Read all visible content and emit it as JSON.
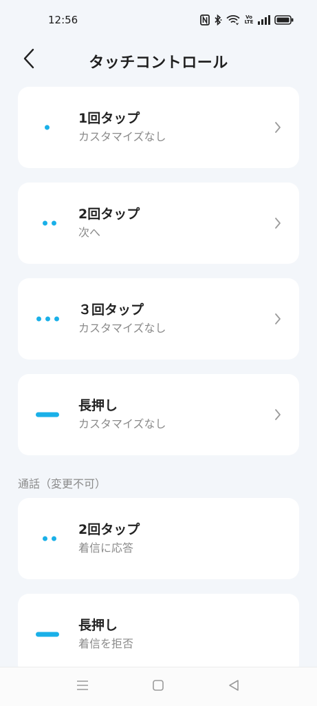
{
  "status_bar": {
    "time": "12:56",
    "icons": [
      "nfc-icon",
      "bluetooth-icon",
      "wifi-icon",
      "volte-icon",
      "signal-icon",
      "battery-icon"
    ],
    "volte_text": "Vo LTE"
  },
  "header": {
    "title": "タッチコントロール",
    "back_icon": "chevron-left-icon"
  },
  "accent_color": "#1ab0e8",
  "gestures": [
    {
      "title": "1回タップ",
      "subtitle": "カスタマイズなし",
      "indicator": "one-dot"
    },
    {
      "title": "2回タップ",
      "subtitle": "次へ",
      "indicator": "two-dots"
    },
    {
      "title": "３回タップ",
      "subtitle": "カスタマイズなし",
      "indicator": "three-dots"
    },
    {
      "title": "長押し",
      "subtitle": "カスタマイズなし",
      "indicator": "bar"
    }
  ],
  "call_section": {
    "label": "通話（変更不可）",
    "items": [
      {
        "title": "2回タップ",
        "subtitle": "着信に応答",
        "indicator": "two-dots"
      },
      {
        "title": "長押し",
        "subtitle": "着信を拒否",
        "indicator": "bar"
      }
    ]
  },
  "nav_bar": {
    "buttons": [
      "menu-icon",
      "home-icon",
      "back-triangle-icon"
    ]
  }
}
